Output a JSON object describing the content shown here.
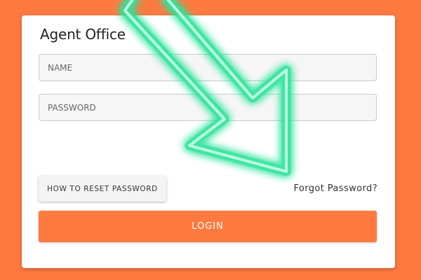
{
  "form": {
    "title": "Agent Office",
    "name_field": {
      "placeholder": "NAME",
      "value": ""
    },
    "password_field": {
      "placeholder": "PASSWORD",
      "value": ""
    },
    "reset_button_label": "HOW TO RESET PASSWORD",
    "forgot_link_label": "Forgot Password?",
    "login_button_label": "LOGIN"
  },
  "overlay": {
    "icon": "neon-arrow-icon",
    "color": "#2de39a"
  },
  "colors": {
    "background": "#ff7a3f",
    "accent": "#ff7a3f",
    "card": "#ffffff"
  }
}
